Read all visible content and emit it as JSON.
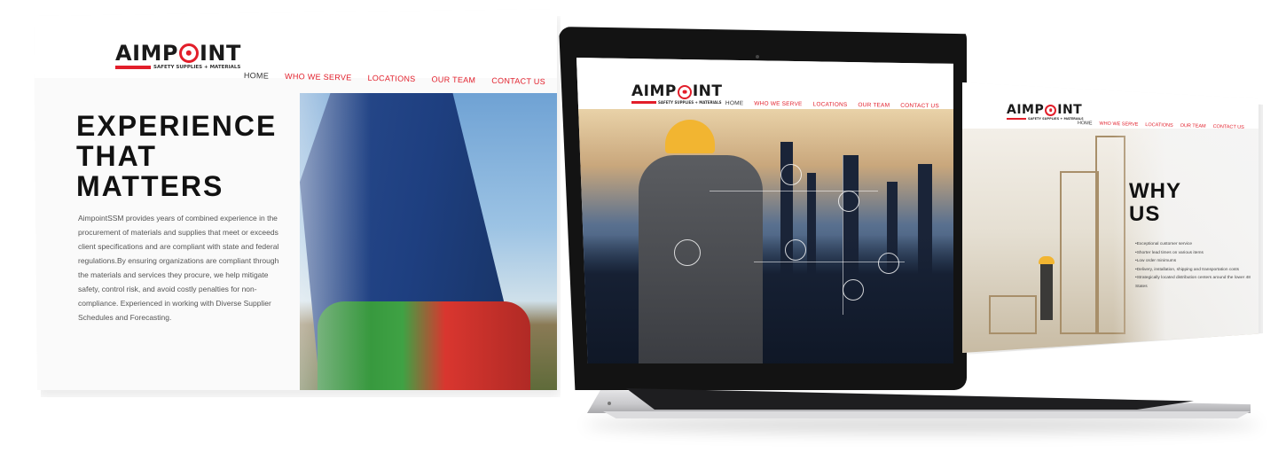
{
  "brand": {
    "logo_word_start": "AIMP",
    "logo_word_end": "INT",
    "tagline": "SAFETY SUPPLIES + MATERIALS",
    "accent_color": "#e21e2a"
  },
  "nav": {
    "items": [
      "HOME",
      "WHO WE SERVE",
      "LOCATIONS",
      "OUR TEAM",
      "CONTACT US"
    ]
  },
  "left_page": {
    "headline": [
      "EXPERIENCE",
      "THAT",
      "MATTERS"
    ],
    "body": "AimpointSSM provides years of combined experience in the procurement of materials and supplies that meet or exceeds client specifications and are compliant with state and federal regulations.By ensuring organizations are compliant through the materials and services they procure, we help mitigate safety, control risk, and avoid costly penalties for non-compliance. Experienced in working with Diverse Supplier Schedules and Forecasting."
  },
  "right_page": {
    "title": [
      "WHY",
      "US"
    ],
    "list": [
      "Exceptional customer service",
      "Shorter lead times on various items",
      "Low order minimums",
      "Delivery, installation, shipping and transportation costs",
      "Strategically located distribution centers around the lower 48 States"
    ]
  },
  "icons": {
    "logo_target": "target-icon",
    "overlay_icons": [
      "water-drop-icon",
      "cloud-icon",
      "gear-icon",
      "user-icon"
    ]
  }
}
